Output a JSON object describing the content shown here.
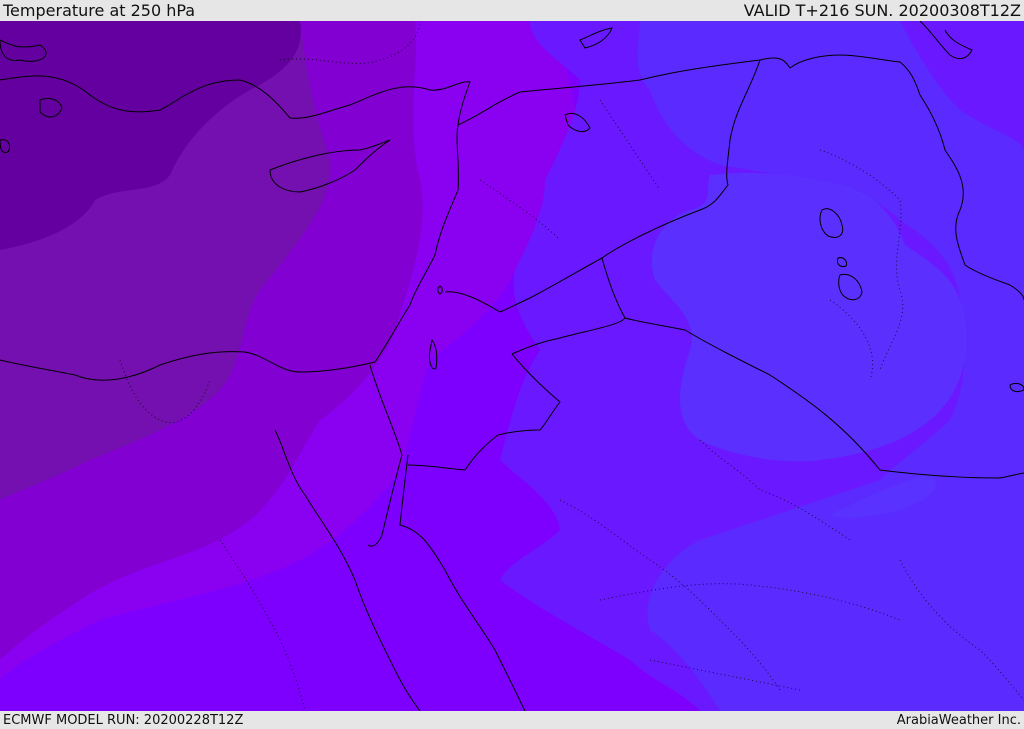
{
  "header": {
    "title": "Temperature at 250 hPa",
    "valid": "VALID T+216 SUN. 20200308T12Z"
  },
  "footer": {
    "model_run": "ECMWF MODEL RUN: 20200228T12Z",
    "credit": "ArabiaWeather Inc."
  },
  "colors": {
    "band_darkest": "#6400a0",
    "band_dark": "#7410b0",
    "band_mid": "#8200d2",
    "band_violet": "#8a00f0",
    "band_purple": "#7d00ff",
    "band_blue_violet": "#6a18ff",
    "band_blue": "#5a2aff",
    "coast": "#000000"
  }
}
